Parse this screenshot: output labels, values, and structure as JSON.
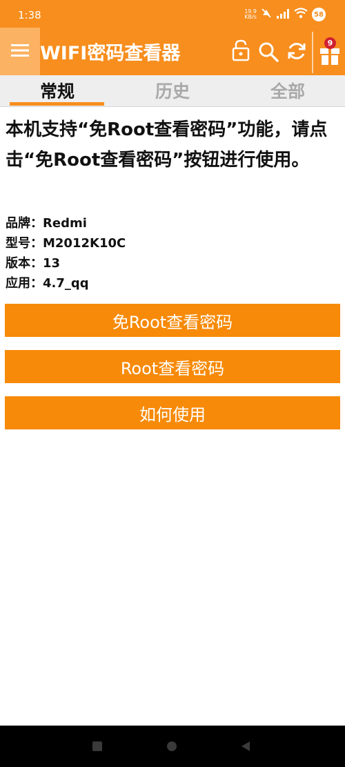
{
  "status_bar": {
    "time": "1:38",
    "net_speed_value": "19.9",
    "net_speed_unit": "KB/s",
    "battery": "58"
  },
  "app_bar": {
    "title": "WIFI密码查看器",
    "gift_badge_count": "9",
    "icons": [
      "menu-icon",
      "unlock-icon",
      "search-icon",
      "refresh-icon",
      "gift-icon"
    ]
  },
  "tabs": [
    {
      "label": "常规",
      "active": true
    },
    {
      "label": "历史",
      "active": false
    },
    {
      "label": "全部",
      "active": false
    }
  ],
  "main": {
    "headline": "本机支持“免Root查看密码”功能，请点击“免Root查看密码”按钮进行使用。",
    "device_info": [
      {
        "text": "品牌：Redmi"
      },
      {
        "text": "型号：M2012K10C"
      },
      {
        "text": "版本：13"
      },
      {
        "text": "应用：4.7_qq"
      }
    ],
    "buttons": [
      {
        "label": "免Root查看密码"
      },
      {
        "label": "Root查看密码"
      },
      {
        "label": "如何使用"
      }
    ]
  },
  "colors": {
    "accent": "#f78e1e",
    "button": "#f78a08",
    "badge": "#d02030"
  },
  "nav_bar": {
    "icons": [
      "recents-icon",
      "home-icon",
      "back-icon"
    ]
  }
}
